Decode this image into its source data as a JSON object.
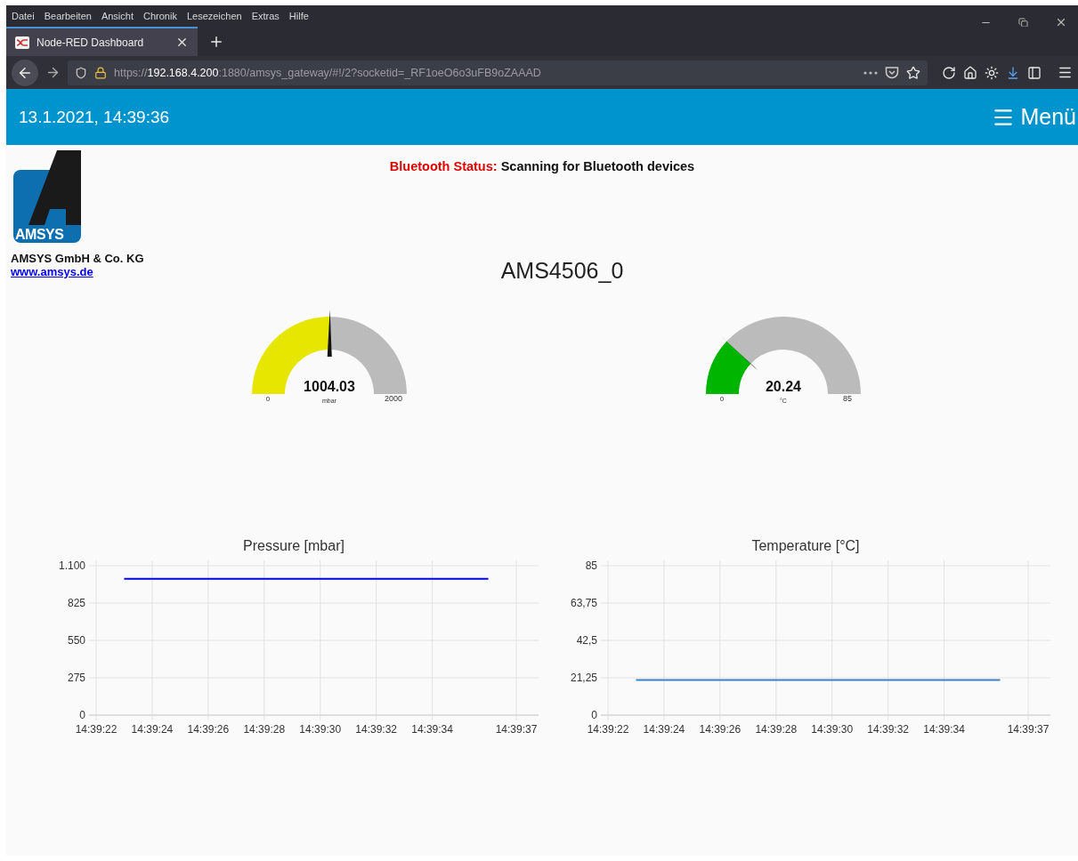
{
  "browser": {
    "menu": [
      "Datei",
      "Bearbeiten",
      "Ansicht",
      "Chronik",
      "Lesezeichen",
      "Extras",
      "Hilfe"
    ],
    "tabs": [
      {
        "title": "Node-RED Dashboard",
        "selected": true
      }
    ],
    "url": "https://**192.168.4.200**:1880/amsys_gateway/#!/2?socketid=_RF1oeO6o3uFB9oZAAAD"
  },
  "header": {
    "datetime": "13.1.2021, 14:39:36",
    "menu_label": "Menü"
  },
  "company": {
    "logo_text": "AMSYS",
    "name": "AMSYS GmbH & Co. KG",
    "link": "www.amsys.de"
  },
  "status": {
    "label": "Bluetooth Status:",
    "value": "Scanning for Bluetooth devices"
  },
  "device_title": "AMS4506_0",
  "gauges": [
    {
      "value": "1004.03",
      "unit": "mbar",
      "min": "0",
      "max": "2000",
      "level": 0.502,
      "color": "#e6e600"
    },
    {
      "value": "20.24",
      "unit": "°C",
      "min": "0",
      "max": "85",
      "level": 0.238,
      "color": "#00b500"
    }
  ],
  "charts": [
    {
      "chart_data": {
        "type": "line",
        "title": "Pressure [mbar]",
        "grid": true,
        "categories": [
          "14:39:22",
          null,
          "14:39:24",
          null,
          "14:39:26",
          null,
          "14:39:28",
          null,
          "14:39:30",
          null,
          "14:39:32",
          null,
          "14:39:34",
          null,
          null,
          "14:39:37"
        ],
        "ylim": [
          0,
          1100
        ],
        "yticks": [
          0,
          275,
          550,
          825,
          {
            "value": 1100,
            "label": "1.100"
          }
        ],
        "series": [
          {
            "color": "#0000dd",
            "values": [
              null,
              1004,
              1004,
              1004,
              1004,
              1004,
              1004,
              1004,
              1004,
              1004,
              1004,
              1004,
              1004,
              1004,
              1004,
              null
            ]
          }
        ]
      }
    },
    {
      "chart_data": {
        "type": "line",
        "title": "Temperature [°C]",
        "grid": true,
        "categories": [
          "14:39:22",
          null,
          "14:39:24",
          null,
          "14:39:26",
          null,
          "14:39:28",
          null,
          "14:39:30",
          null,
          "14:39:32",
          null,
          "14:39:34",
          null,
          null,
          "14:39:37"
        ],
        "ylim": [
          0,
          85
        ],
        "yticks": [
          0,
          {
            "value": 21.25,
            "label": "21,25"
          },
          {
            "value": 42.5,
            "label": "42,5"
          },
          {
            "value": 63.75,
            "label": "63,75"
          },
          85
        ],
        "series": [
          {
            "color": "#3b82c4",
            "values": [
              null,
              20,
              20,
              20,
              20,
              20,
              20,
              20,
              20,
              20,
              20,
              20,
              20,
              20,
              20,
              null
            ]
          }
        ]
      }
    }
  ]
}
